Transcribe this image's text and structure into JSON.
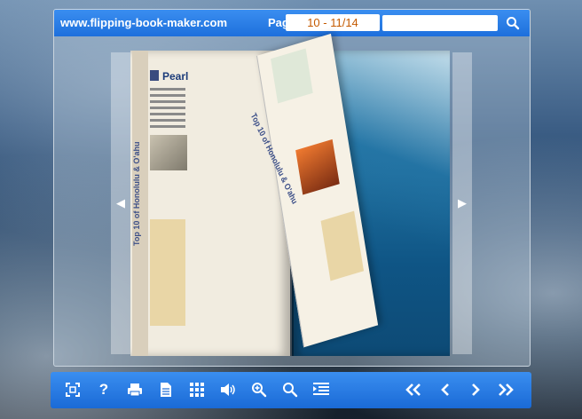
{
  "header": {
    "site_title": "www.flipping-book-maker.com",
    "pages_label": "Pages:",
    "page_value": "10 - 11/14",
    "search_placeholder": ""
  },
  "book": {
    "left_page_side_title": "Top 10 of Honolulu & O'ahu",
    "left_page_heading": "Pearl",
    "flip_page_side_title": "Top 10 of Honolulu & O'ahu"
  },
  "toolbar": {
    "icons": [
      "fullscreen-icon",
      "help-icon",
      "print-icon",
      "pages-icon",
      "thumbnails-icon",
      "sound-icon",
      "zoom-in-icon",
      "search-icon",
      "table-of-contents-icon",
      "first-page-icon",
      "previous-page-icon",
      "next-page-icon",
      "last-page-icon"
    ]
  },
  "colors": {
    "bar_blue": "#1d6fdc",
    "page_number_text": "#c45a00"
  }
}
